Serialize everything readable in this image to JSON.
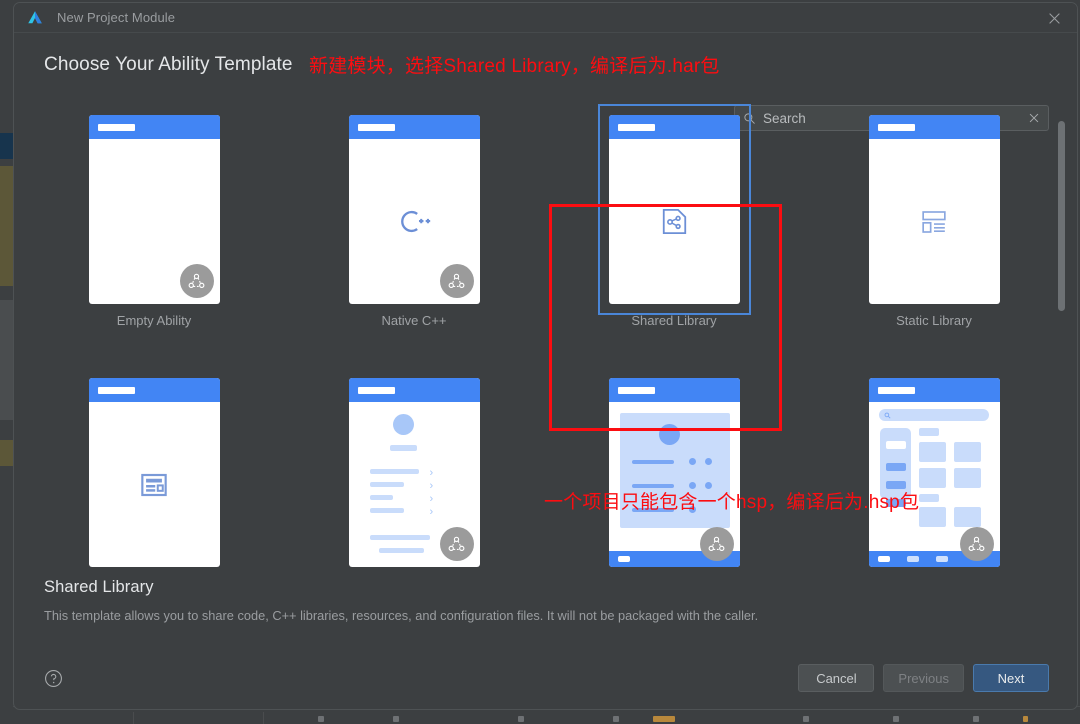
{
  "window": {
    "title": "New Project Module",
    "logo_icon": "deveco-logo-icon",
    "close_icon": "close-icon"
  },
  "header": {
    "title": "Choose Your Ability Template",
    "annotation_top": "新建模块，选择Shared Library，编译后为.har包",
    "annotation_mid": "一个项目只能包含一个hsp，编译后为.hsp包"
  },
  "search": {
    "value": "",
    "placeholder": "Search",
    "icon": "search-icon",
    "clear_icon": "close-icon"
  },
  "templates": [
    {
      "label": "Empty Ability",
      "icon": "blank-page-icon",
      "selected": false,
      "badge": true,
      "style": "plain"
    },
    {
      "label": "Native C++",
      "icon": "cpp-icon",
      "selected": false,
      "badge": true,
      "style": "cpp"
    },
    {
      "label": "Shared Library",
      "icon": "shared-library-icon",
      "selected": true,
      "badge": false,
      "style": "share"
    },
    {
      "label": "Static Library",
      "icon": "static-library-icon",
      "selected": false,
      "badge": false,
      "style": "static"
    },
    {
      "label": "",
      "icon": "card-layout-icon",
      "selected": false,
      "badge": false,
      "style": "card"
    },
    {
      "label": "",
      "icon": "list-profile-icon",
      "selected": false,
      "badge": true,
      "style": "profile"
    },
    {
      "label": "",
      "icon": "grid-detail-icon",
      "selected": false,
      "badge": true,
      "style": "detail"
    },
    {
      "label": "",
      "icon": "catalog-grid-icon",
      "selected": false,
      "badge": true,
      "style": "catalog"
    }
  ],
  "description": {
    "title": "Shared Library",
    "text": "This template allows you to share code, C++ libraries, resources, and configuration files. It will not be packaged with the caller."
  },
  "footer": {
    "help_icon": "help-circle-icon",
    "cancel_label": "Cancel",
    "previous_label": "Previous",
    "next_label": "Next"
  },
  "colors": {
    "accent_blue": "#4285f4",
    "selection_blue": "#4a86d8",
    "annotation_red": "#fc0d11",
    "primary_button": "#365880",
    "dialog_bg": "#3c3f41"
  }
}
